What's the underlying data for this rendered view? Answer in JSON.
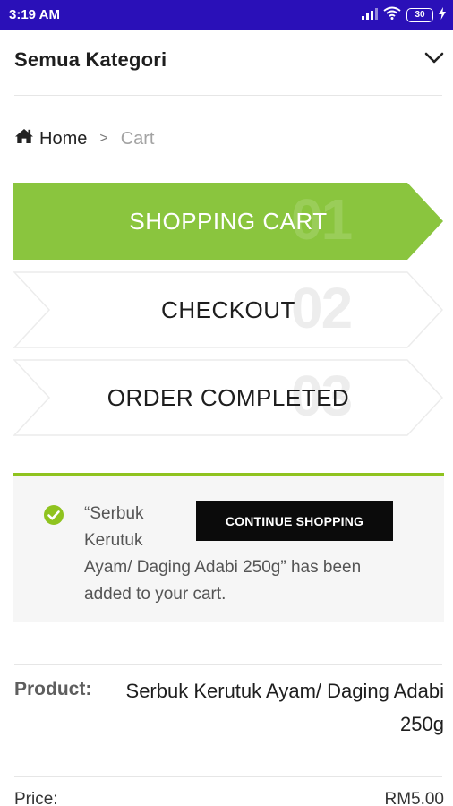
{
  "status_bar": {
    "time": "3:19 AM",
    "battery": "30"
  },
  "header": {
    "category_label": "Semua Kategori"
  },
  "breadcrumb": {
    "home": "Home",
    "separator": ">",
    "current": "Cart"
  },
  "steps": [
    {
      "number": "01",
      "label": "SHOPPING CART",
      "active": true
    },
    {
      "number": "02",
      "label": "CHECKOUT",
      "active": false
    },
    {
      "number": "03",
      "label": "ORDER COMPLETED",
      "active": false
    }
  ],
  "notice": {
    "message": "“Serbuk Kerutuk Ayam/ Daging Adabi 250g” has been added to your cart.",
    "button_label": "CONTINUE SHOPPING"
  },
  "cart_item": {
    "product_label": "Product:",
    "product_name": "Serbuk Kerutuk Ayam/ Daging Adabi 250g",
    "price_label": "Price:",
    "price_value": "RM5.00"
  },
  "colors": {
    "status_bar": "#2a10b8",
    "accent_green": "#8fc31f",
    "active_step": "#8ac53e"
  },
  "icons": [
    "signal-icon",
    "wifi-icon",
    "battery-icon",
    "bolt-icon",
    "chevron-down-icon",
    "home-icon",
    "check-circle-icon"
  ]
}
